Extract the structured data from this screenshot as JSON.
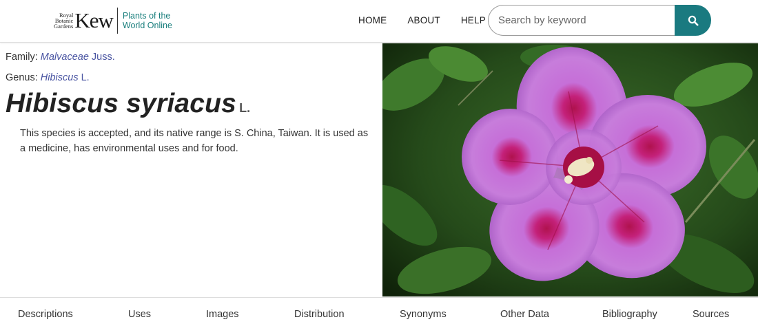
{
  "header": {
    "logo": {
      "small_lines": [
        "Royal",
        "Botanic",
        "Gardens"
      ],
      "brand": "Kew",
      "product_lines": [
        "Plants of the",
        "World Online"
      ]
    },
    "nav": [
      {
        "label": "HOME"
      },
      {
        "label": "ABOUT"
      },
      {
        "label": "HELP"
      }
    ],
    "search": {
      "placeholder": "Search by keyword",
      "value": "",
      "button_icon": "search-icon"
    }
  },
  "taxon": {
    "family_label": "Family:",
    "family_name": "Malvaceae",
    "family_author": "Juss.",
    "genus_label": "Genus:",
    "genus_name": "Hibiscus",
    "genus_author": "L.",
    "species_name": "Hibiscus syriacus",
    "species_author": "L.",
    "summary": "This species is accepted, and its native range is S. China, Taiwan. It is used as a medicine, has environmental uses and for food."
  },
  "tabs": [
    {
      "label": "Descriptions"
    },
    {
      "label": "Uses"
    },
    {
      "label": "Images"
    },
    {
      "label": "Distribution"
    },
    {
      "label": "Synonyms"
    },
    {
      "label": "Other Data"
    },
    {
      "label": "Bibliography"
    },
    {
      "label": "Sources"
    }
  ],
  "colors": {
    "accent_teal": "#1a7a80",
    "link_blue": "#4a55a2",
    "flower_pink": "#c26ad6",
    "flower_center": "#b0124e",
    "foliage": "#2f5a22"
  }
}
